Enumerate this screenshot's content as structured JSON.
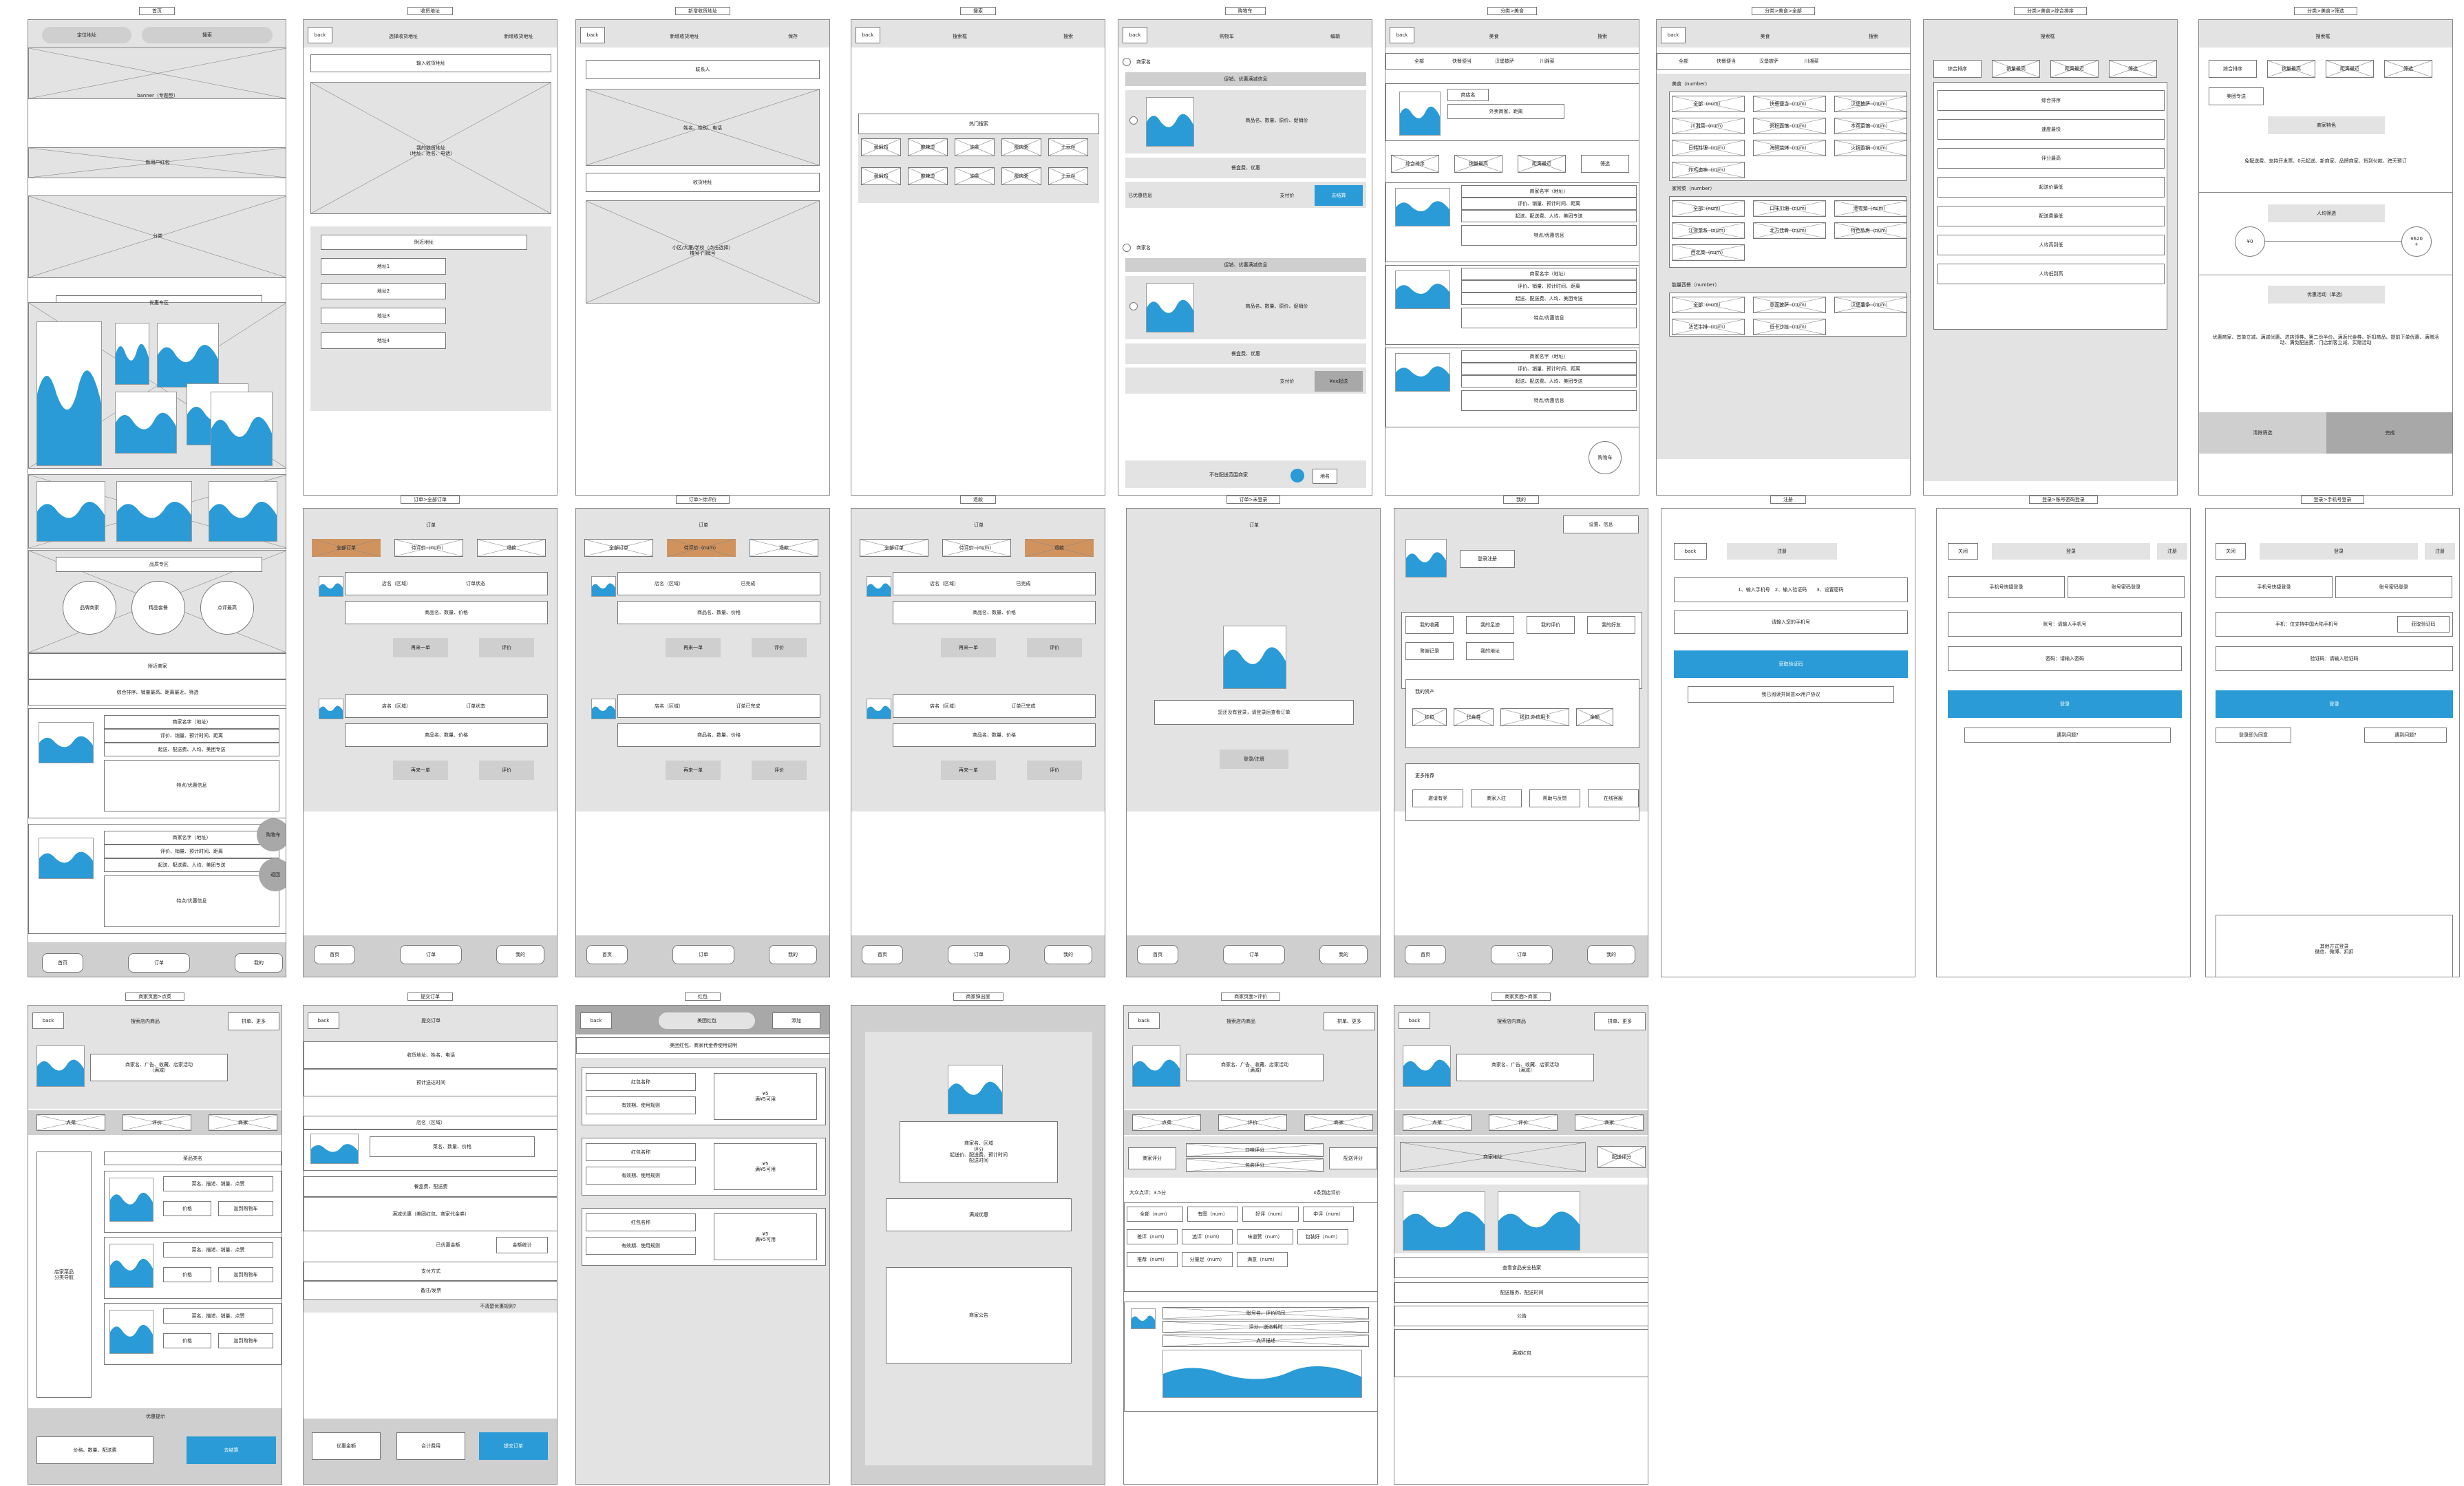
{
  "f1": {
    "title": "首页",
    "loc": "定位地址",
    "search": "搜索",
    "banner": "banner（专题型）",
    "newred": "新用户红包",
    "cat": "分类",
    "youhui": "优惠专区",
    "brandzone": "品质专区",
    "b1": "品牌商家",
    "b2": "精品套餐",
    "b3": "点评最高",
    "nearby": "附近商家",
    "sort": "综合排序、销量最高、距离最近、筛选",
    "mname": "商家名字（地址）",
    "minfo1": "评价、销量、预计时间、距离",
    "minfo2": "起送、配送费、人均、美团专送",
    "feature": "特点/优惠信息",
    "cart": "购物车",
    "totop": "返回",
    "tab1": "首页",
    "tab2": "订单",
    "tab3": "我的"
  },
  "f2": {
    "title": "收货地址",
    "back": "back",
    "hdr": "选择收货地址",
    "add": "新增收货地址",
    "input": "输入收货地址",
    "mine": "我的收货地址\n（地址、姓名、电话）",
    "near": "附近地址",
    "a1": "地址1",
    "a2": "地址2",
    "a3": "地址3",
    "a4": "地址4"
  },
  "f3": {
    "title": "新增收货地址",
    "back": "back",
    "hdr": "新增收货地址",
    "save": "保存",
    "contact": "联系人",
    "info": "姓名、性别、电话",
    "addr": "收货地址",
    "detail": "小区/大厦/学校（点击选择）\n楼号-门牌号"
  },
  "f4": {
    "title": "搜索",
    "back": "back",
    "box": "搜索框",
    "btn": "搜索",
    "hot": "热门搜索",
    "tags": [
      "黄焖鸡",
      "麻辣烫",
      "油条",
      "瘦肉粥",
      "土豆丝",
      "黄焖鸡",
      "麻辣烫",
      "油条",
      "瘦肉粥",
      "土豆丝"
    ]
  },
  "f5": {
    "title": "购物车",
    "back": "back",
    "hdr": "购物车",
    "edit": "编辑",
    "store": "商家名",
    "promo": "促销、优惠满减信息",
    "goods": "商品名、数量、原价、促销价",
    "fee": "餐盒费、优惠",
    "saved": "已优惠信息",
    "pay": "支付价",
    "checkout": "去结算",
    "delivery": "¥xx起送",
    "nodel": "不在配送范围商家",
    "addr": "地名"
  },
  "f6": {
    "title": "分类>美食",
    "back": "back",
    "hdr": "美食",
    "search": "搜索",
    "tabs": [
      "全部",
      "快餐便当",
      "汉堡披萨",
      "川湘菜"
    ],
    "storename": "商店名",
    "pinfo": "外卖商家、距离",
    "f": [
      "综合排序",
      "销量最高",
      "距离最近",
      "筛选"
    ],
    "mname": "商家名字（地址）",
    "m1": "评价、销量、预计时间、距离",
    "m2": "起送、配送费、人均、美团专送",
    "feat": "特点/优惠信息",
    "logo": "商家logo",
    "cart": "购物车"
  },
  "f7": {
    "title": "分类>美食>全部",
    "back": "back",
    "hdr": "美食",
    "search": "搜索",
    "tabs": [
      "全部",
      "快餐便当",
      "汉堡披萨",
      "川湘菜"
    ],
    "g1": "美食（number）",
    "g1i": [
      "全部（num）",
      "快餐便当（num）",
      "汉堡披萨（num）",
      "川湘菜（num）",
      "粥粉面馆（num）",
      "本帮菜馆（num）",
      "日韩料理（num）",
      "海鲜烧烤（num）",
      "火锅香锅（num）",
      "炸鸡卤味（num）"
    ],
    "g2": "家常菜（number）",
    "g2i": [
      "全部（num）",
      "口味川湘（num）",
      "港粤菜（num）",
      "江浙菜系（num）",
      "北方佳肴（num）",
      "特色私房（num）",
      "西北菜（num）"
    ],
    "g3": "能量西餐（number）",
    "g3i": [
      "全部（num）",
      "意面披萨（num）",
      "汉堡薯条（num）",
      "法艺牛排（num）",
      "低卡沙拉（num）"
    ]
  },
  "f8": {
    "title": "分类>美食>综合排序",
    "box": "搜索框",
    "f": [
      "综合排序",
      "销量最高",
      "距离最近",
      "筛选"
    ],
    "opts": [
      "综合排序",
      "速度最快",
      "评分最高",
      "起送价最低",
      "配送费最低",
      "人均高到低",
      "人均低到高"
    ]
  },
  "f9": {
    "title": "分类>美食>筛选",
    "box": "搜索框",
    "f": [
      "综合排序",
      "销量最高",
      "距离最近",
      "筛选"
    ],
    "mt": "美团专送",
    "feat": "商家特色",
    "feattxt": "免配送费、支持开发票、0元起送、新商家、品牌商家、货到付款、跨天预订",
    "price": "人均筛选",
    "lo": "¥0",
    "hi": "¥620\n+",
    "act": "优惠活动（单选）",
    "acttxt": "优惠商家、首单立减、满减优惠、进店领券、第二份半价、满返代金券、折扣商品、提前下单优惠、满赠活动、满免配送费、门店新客立减、买赠活动",
    "clear": "清除筛选",
    "done": "完成"
  },
  "f10": {
    "title": "订单>全部订单",
    "hdr": "订单",
    "tabs": [
      "全部订单",
      "待评价（num）",
      "退款"
    ],
    "store": "店名（区域）",
    "status": "订单状态",
    "goods": "商品名、数量、价格",
    "again": "再来一单",
    "review": "评价",
    "tab1": "首页",
    "tab2": "订单",
    "tab3": "我的"
  },
  "f11": {
    "title": "订单>待评价",
    "hdr": "订单",
    "tabs": [
      "全部订单",
      "待评价（num）",
      "退款"
    ],
    "store": "店名（区域）",
    "done": "已完成",
    "done2": "订单已完成",
    "goods": "商品名、数量、价格",
    "again": "再来一单",
    "review": "评价",
    "tab1": "首页",
    "tab2": "订单",
    "tab3": "我的"
  },
  "f12": {
    "title": "退款",
    "hdr": "订单",
    "tabs": [
      "全部订单",
      "待评价（num）",
      "退款"
    ],
    "store": "店名（区域）",
    "done": "已完成",
    "done2": "订单已完成",
    "goods": "商品名、数量、价格",
    "again": "再来一单",
    "review": "评价",
    "tab1": "首页",
    "tab2": "订单",
    "tab3": "我的"
  },
  "f13": {
    "title": "订单>未登录",
    "hdr": "订单",
    "msg": "您还没有登录，请登录后查看订单",
    "btn": "登录/注册",
    "tab1": "首页",
    "tab2": "订单",
    "tab3": "我的"
  },
  "f14": {
    "title": "我的",
    "settings": "设置、信息",
    "avatar": "头像",
    "login": "登录注册",
    "r1": [
      "我的收藏",
      "我的足迹",
      "我的评价",
      "我的好友"
    ],
    "r2": [
      "答谢记录",
      "我的地址"
    ],
    "assets": "我的资产",
    "a": [
      "红包",
      "代金券",
      "钱包 办信用卡",
      "余额"
    ],
    "more": "更多推荐",
    "m": [
      "邀请有奖",
      "商家入驻",
      "帮助与反馈",
      "在线客服"
    ],
    "tab1": "首页",
    "tab2": "订单",
    "tab3": "我的"
  },
  "f15": {
    "title": "注册",
    "back": "back",
    "hdr": "注册",
    "steps": "1、输入手机号　2、输入验证码　　3、设置密码",
    "phone": "请输入您的手机号",
    "code": "获取验证码",
    "agree": "我已阅读并同意xx用户协议"
  },
  "f16": {
    "title": "登录>账号密码登录",
    "close": "关闭",
    "hdr": "登录",
    "reg": "注册",
    "t1": "手机号快捷登录",
    "t2": "账号密码登录",
    "acc": "账号：请输入手机号",
    "pwd": "密码：请输入密码",
    "login": "登录",
    "help": "遇到问题?"
  },
  "f17": {
    "title": "登录>手机号登录",
    "close": "关闭",
    "hdr": "登录",
    "reg": "注册",
    "t1": "手机号快捷登录",
    "t2": "账号密码登录",
    "phone": "手机：仅支持中国大陆手机号",
    "getcode": "获取验证码",
    "code": "验证码：请输入验证码",
    "login": "登录",
    "agree": "登录即为同意",
    "help": "遇到问题?",
    "other": "其他方式登录\n微信、微博、扣扣"
  },
  "f18": {
    "title": "商家页面>点菜",
    "back": "back",
    "search": "搜索店内商品",
    "more": "拼单、更多",
    "logo": "商家logo",
    "info": "商家名、广告、收藏、店家活动\n（满减）",
    "tabs": [
      "点菜",
      "评价",
      "商家"
    ],
    "nav": "店家菜品\n分类导航",
    "catname": "菜品类名",
    "dish": "菜名、描述、销量、点赞",
    "price": "价格",
    "addcart": "加到购物车",
    "pic": "菜品图片",
    "tip": "优惠提示",
    "sum": "价格、数量、配送费",
    "checkout": "去结算"
  },
  "f19": {
    "title": "提交订单",
    "back": "back",
    "hdr": "提交订单",
    "addr": "收货地址、姓名、电话",
    "time": "预计送达时间",
    "store": "店名（区域）",
    "logo": "商家logo",
    "goods": "菜名、数量、价格",
    "fee": "餐盒费、配送费",
    "discount": "满减优惠（美团红包、商家代金券）",
    "saved": "已优惠金额",
    "total": "金额统计",
    "pay": "支付方式",
    "note": "备注/发票",
    "rules": "不清楚优惠规则?",
    "b1": "优惠金额",
    "b2": "合计费用",
    "b3": "提交订单"
  },
  "f20": {
    "title": "红包",
    "back": "back",
    "hdr": "美团红包",
    "add": "添加",
    "desc": "美团红包、商家代金券使用说明",
    "name": "红包名称",
    "valid": "有效期、使用规则",
    "amount": "¥5\n满¥5可用"
  },
  "f21": {
    "title": "商家弹出层",
    "logo": "商家logo",
    "info": "商家名、区域\n评分\n起送价、配送费、预计时间\n配送时间",
    "discount": "满减优惠",
    "notice": "商家公告"
  },
  "f22": {
    "title": "商家页面>评价",
    "back": "back",
    "search": "搜索店内商品",
    "more": "拼单、更多",
    "logo": "商家logo",
    "info": "商家名、广告、收藏、店家活动\n（满减）",
    "tabs": [
      "点菜",
      "评价",
      "商家"
    ],
    "s1": "商家评分",
    "s2": "口味评分",
    "s3": "包装评分",
    "s4": "配送评分",
    "public": "大众点评：3.5分",
    "x": "x条到店评价",
    "tags": [
      "全部（num）",
      "有图（num）",
      "好评（num）",
      "中评（num）",
      "差评（num）",
      "追评（num）",
      "味道赞（num）",
      "包装好（num）",
      "推荐（num）",
      "分量足（num）",
      "满意（num）"
    ],
    "avatar": "头像",
    "acc": "账号名、评价时间",
    "rate": "评分、送达耗时",
    "desc": "点评描述",
    "pic": "照片上图"
  },
  "f23": {
    "title": "商家页面>商家",
    "back": "back",
    "search": "搜索店内商品",
    "more": "拼单、更多",
    "logo": "商家logo",
    "info": "商家名、广告、收藏、店家活动\n（满减）",
    "tabs": [
      "点菜",
      "评价",
      "商家"
    ],
    "addr": "商家地址",
    "tel": "配送评分",
    "pic": "商家图片",
    "safety": "查看食品安全档案",
    "svc": "配送服务、配送时间",
    "notice": "公告",
    "red": "满减红包"
  }
}
